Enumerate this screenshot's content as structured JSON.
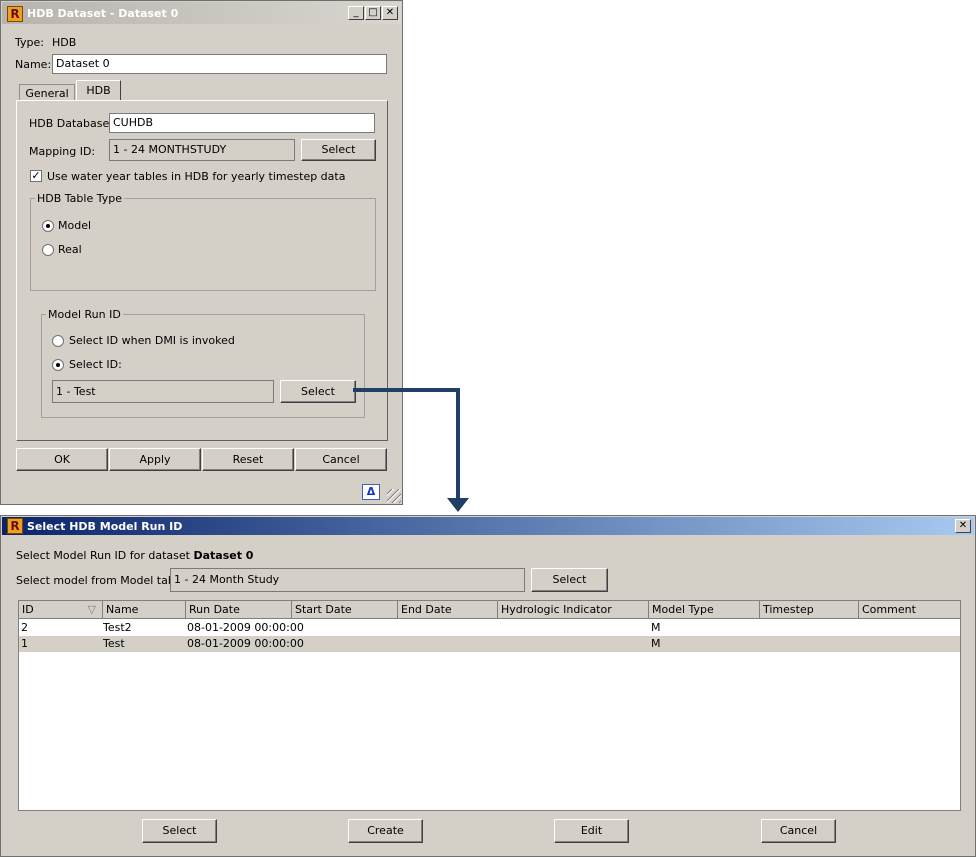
{
  "dataset_window": {
    "title": "HDB Dataset - Dataset 0",
    "type_label": "Type:",
    "type_value": "HDB",
    "name_label": "Name:",
    "name_value": "Dataset 0",
    "tabs": [
      {
        "label": "General",
        "active": false
      },
      {
        "label": "HDB",
        "active": true
      }
    ],
    "hdb_database_label": "HDB Database:",
    "hdb_database_value": "CUHDB",
    "mapping_id_label": "Mapping ID:",
    "mapping_id_value": "1 - 24 MONTHSTUDY",
    "mapping_select_label": "Select",
    "water_year_label": "Use water year tables in HDB for yearly timestep data",
    "water_year_checked": true,
    "table_type_title": "HDB Table Type",
    "table_type_options": [
      {
        "label": "Model",
        "selected": true
      },
      {
        "label": "Real",
        "selected": false
      }
    ],
    "model_run_title": "Model Run ID",
    "model_run_options": [
      {
        "label": "Select ID when DMI is invoked",
        "selected": false
      },
      {
        "label": "Select ID:",
        "selected": true
      }
    ],
    "model_run_value": "1 - Test",
    "model_run_select_label": "Select",
    "buttons": {
      "ok": "OK",
      "apply": "Apply",
      "reset": "Reset",
      "cancel": "Cancel"
    }
  },
  "select_window": {
    "title": "Select HDB Model Run ID",
    "prompt_prefix": "Select Model Run ID for dataset",
    "prompt_dataset": "Dataset 0",
    "model_label": "Select model from Model table:",
    "model_value": "1 - 24 Month Study",
    "model_select_label": "Select",
    "columns": [
      "ID",
      "Name",
      "Run Date",
      "Start Date",
      "End Date",
      "Hydrologic Indicator",
      "Model Type",
      "Timestep",
      "Comment"
    ],
    "rows": [
      [
        "2",
        "Test2",
        "08-01-2009 00:00:00",
        "",
        "",
        "",
        "M",
        "",
        ""
      ],
      [
        "1",
        "Test",
        "08-01-2009 00:00:00",
        "",
        "",
        "",
        "M",
        "",
        ""
      ]
    ],
    "buttons": {
      "select": "Select",
      "create": "Create",
      "edit": "Edit",
      "cancel": "Cancel"
    }
  },
  "colors": {
    "connector": "#1f3f66",
    "selected_row": "#d4d0c8"
  }
}
